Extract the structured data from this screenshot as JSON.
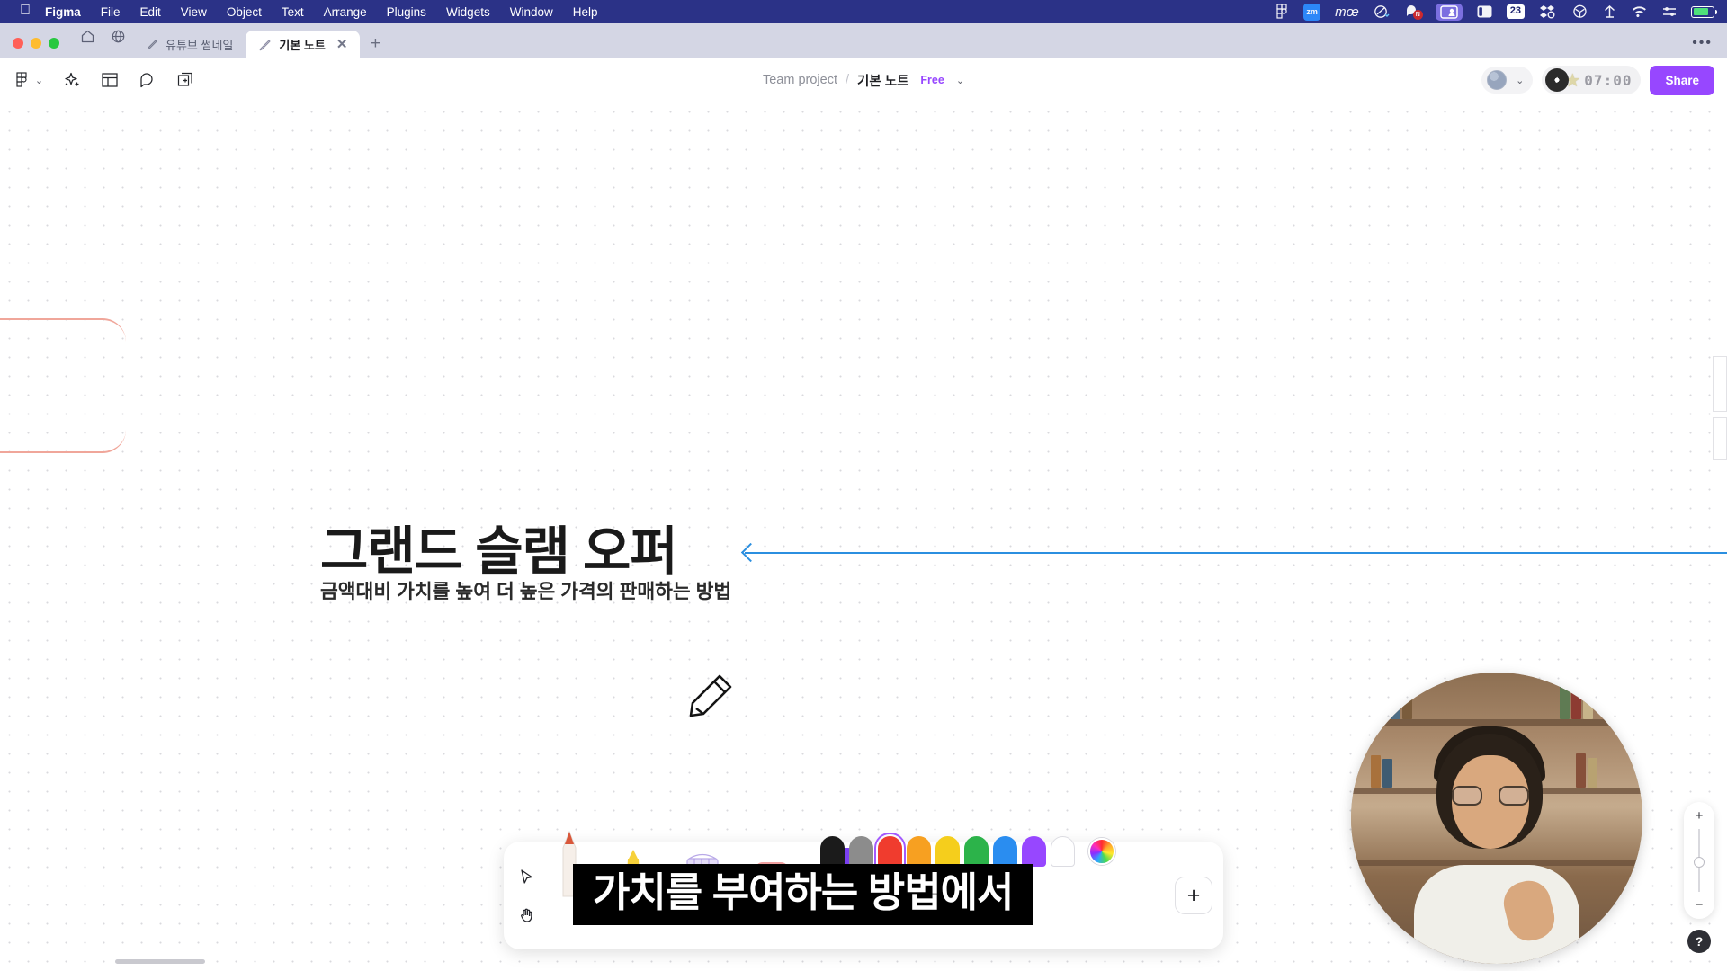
{
  "menubar": {
    "apple_icon": "apple-icon",
    "items": [
      {
        "label": "Figma",
        "bold": true
      },
      {
        "label": "File",
        "bold": false
      },
      {
        "label": "Edit",
        "bold": false
      },
      {
        "label": "View",
        "bold": false
      },
      {
        "label": "Object",
        "bold": false
      },
      {
        "label": "Text",
        "bold": false
      },
      {
        "label": "Arrange",
        "bold": false
      },
      {
        "label": "Plugins",
        "bold": false
      },
      {
        "label": "Widgets",
        "bold": false
      },
      {
        "label": "Window",
        "bold": false
      },
      {
        "label": "Help",
        "bold": false
      }
    ],
    "tray": {
      "figma_icon": "figma-logo-icon",
      "zoom_icon": "zoom-app-icon",
      "zoom_label": "zm",
      "moo_label": "mœ",
      "cleanshot_icon": "cleanshot-icon",
      "notification_icon": "notification-bubble-icon",
      "notification_badge": "N",
      "screenshare_icon": "screen-share-icon",
      "sidebar_icon": "sidebar-toggle-icon",
      "day_counter": "23",
      "dropbox_icon": "dropbox-sync-icon",
      "openai_icon": "openai-icon",
      "download_icon": "download-arrow-icon",
      "wifi_icon": "wifi-icon",
      "control_center_icon": "control-center-icon",
      "battery_icon": "battery-icon"
    }
  },
  "tabstrip": {
    "home_icon": "home-icon",
    "globe_icon": "globe-icon",
    "tabs": [
      {
        "label": "유튜브 썸네일",
        "icon": "figjam-pen-icon",
        "active": false
      },
      {
        "label": "기본 노트",
        "icon": "figjam-pen-icon",
        "active": true
      }
    ],
    "close_label": "✕",
    "new_tab_label": "+",
    "overflow_label": "•••"
  },
  "header": {
    "tools": [
      {
        "name": "figma-menu-icon",
        "label": ""
      },
      {
        "name": "ai-sparkle-icon",
        "label": ""
      },
      {
        "name": "section-template-icon",
        "label": ""
      },
      {
        "name": "comment-icon",
        "label": ""
      },
      {
        "name": "add-widget-icon",
        "label": ""
      }
    ],
    "breadcrumb": {
      "project": "Team project",
      "separator": "/",
      "file": "기본 노트",
      "plan_badge": "Free",
      "chevron": "⌄"
    },
    "presence": {
      "avatar_name": "collaborator-avatar",
      "chevron": "⌄"
    },
    "timer_widget": {
      "record_icon": "music-record-icon",
      "star_icon": "star-icon",
      "time": "07:00"
    },
    "share_label": "Share"
  },
  "canvas": {
    "headline": "그랜드 슬램 오퍼",
    "subline": "금액대비 가치를 높여 더 높은 가격의 판매하는 방법",
    "arrow_name": "blue-connector-arrow",
    "pencil_cursor_name": "pencil-cursor-icon",
    "frame_name": "salmon-frame-outline"
  },
  "caption": {
    "text": "가치를 부여하는 방법에서"
  },
  "bottombar": {
    "cursor_icon": "cursor-arrow-icon",
    "hand_icon": "hand-tool-icon",
    "pens": [
      {
        "name": "pencil-tool",
        "color": "#f3ece7",
        "tip": "#c04a28"
      },
      {
        "name": "highlighter-yellow-tool",
        "color": "#f7d13a"
      },
      {
        "name": "grid-ruler-tool",
        "color": "#ded4f7"
      },
      {
        "name": "eraser-tool",
        "color": "#f0a0a0"
      },
      {
        "name": "marker-purple-tool",
        "color": "#7b3ff2",
        "selected": true
      },
      {
        "name": "dot-tool",
        "color": "#8a8a8a"
      }
    ],
    "swatches": [
      {
        "name": "swatch-black",
        "color": "#1b1b1b",
        "selected": false
      },
      {
        "name": "swatch-gray",
        "color": "#8c8c8c",
        "selected": false
      },
      {
        "name": "swatch-red",
        "color": "#f03c2e",
        "selected": true
      },
      {
        "name": "swatch-orange",
        "color": "#f7a021",
        "selected": false
      },
      {
        "name": "swatch-yellow",
        "color": "#f5ce1c",
        "selected": false
      },
      {
        "name": "swatch-green",
        "color": "#2cb34a",
        "selected": false
      },
      {
        "name": "swatch-blue",
        "color": "#2a8df0",
        "selected": false
      },
      {
        "name": "swatch-purple",
        "color": "#9747ff",
        "selected": false
      },
      {
        "name": "swatch-white",
        "color": "#ffffff",
        "selected": false
      }
    ],
    "color_wheel_name": "color-wheel-picker",
    "add_label": "+"
  },
  "zoom_controls": {
    "zoom_in_label": "+",
    "zoom_out_label": "−",
    "help_label": "?"
  },
  "colors": {
    "menubar_bg": "#2b3287",
    "accent_purple": "#9747ff",
    "arrow_blue": "#2b8fe0",
    "frame_salmon": "#f0a69a"
  }
}
